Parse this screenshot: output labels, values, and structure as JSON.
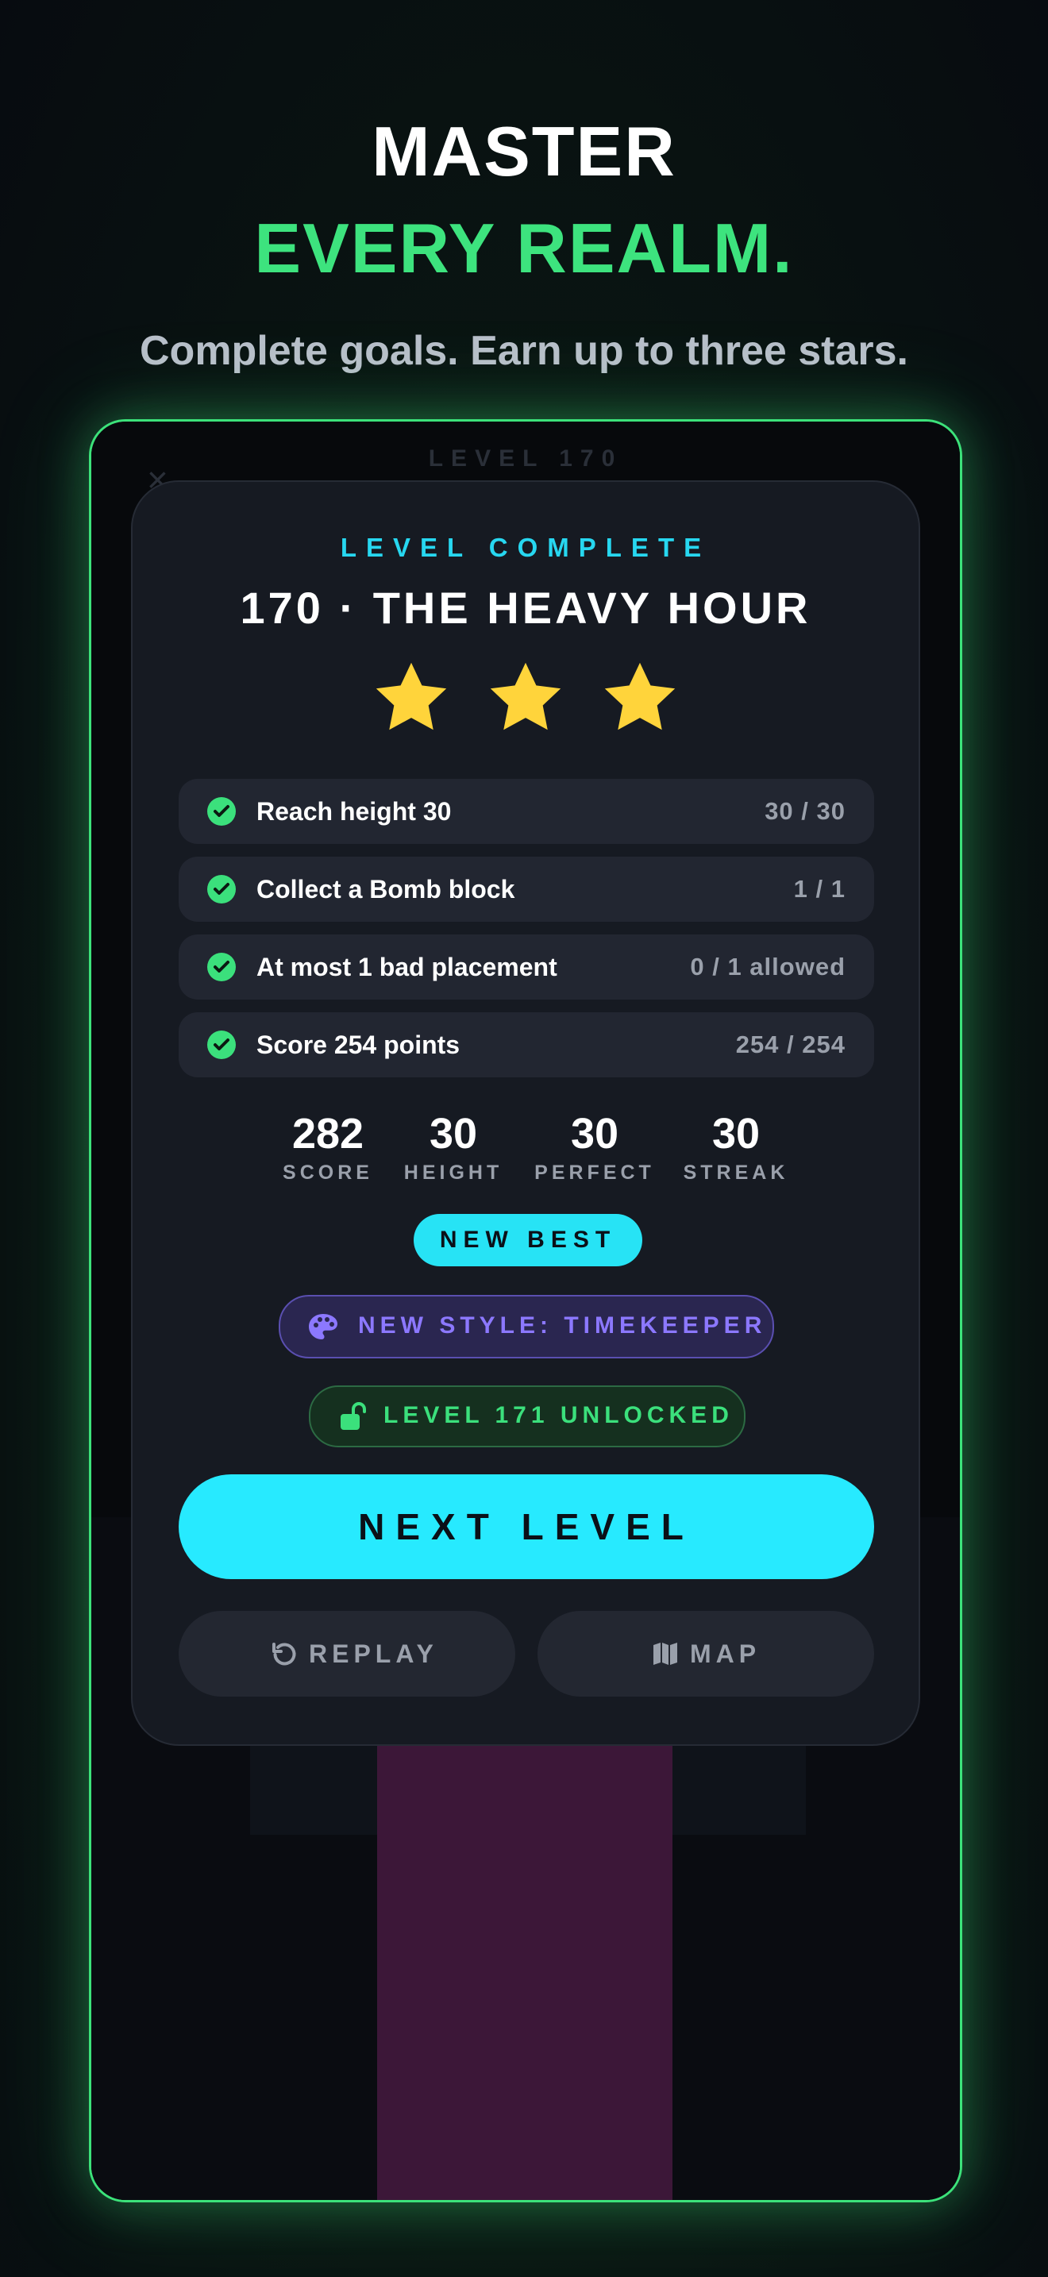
{
  "header": {
    "line1": "MASTER",
    "line2": "EVERY REALM.",
    "subtitle": "Complete goals. Earn up to three stars."
  },
  "game_background": {
    "level_label": "LEVEL 170",
    "close_glyph": "×"
  },
  "modal": {
    "label": "LEVEL COMPLETE",
    "title": "170 · THE HEAVY HOUR",
    "stars_earned": 3,
    "stars_total": 3,
    "goals": [
      {
        "text": "Reach height 30",
        "value": "30 / 30",
        "complete": true
      },
      {
        "text": "Collect a Bomb block",
        "value": "1 / 1",
        "complete": true
      },
      {
        "text": "At most 1 bad placement",
        "value": "0 / 1 allowed",
        "complete": true
      },
      {
        "text": "Score 254 points",
        "value": "254 / 254",
        "complete": true
      }
    ],
    "stats": [
      {
        "value": "282",
        "label": "SCORE"
      },
      {
        "value": "30",
        "label": "HEIGHT"
      },
      {
        "value": "30",
        "label": "PERFECT"
      },
      {
        "value": "30",
        "label": "STREAK"
      }
    ],
    "badge_new_best": "NEW BEST",
    "new_style": "NEW STYLE: TIMEKEEPER",
    "unlocked": "LEVEL 171 UNLOCKED",
    "next_button": "NEXT LEVEL",
    "replay_button": "REPLAY",
    "map_button": "MAP"
  },
  "colors": {
    "accent_green": "#3de37e",
    "accent_cyan": "#27eaff",
    "style_purple": "#8c78ff",
    "star_yellow": "#ffd43b"
  }
}
